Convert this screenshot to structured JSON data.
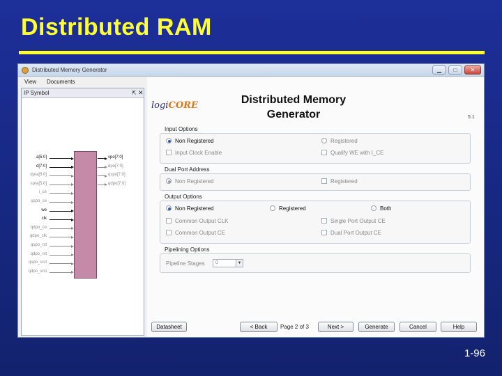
{
  "slide": {
    "title": "Distributed RAM",
    "number": "1-96",
    "title_color": "#ffff33",
    "background_color": "#1a2b8c"
  },
  "window": {
    "title": "Distributed Memory Generator",
    "icon": "app-icon",
    "controls": {
      "minimize": "▁",
      "maximize": "□",
      "close": "✕"
    },
    "menu": [
      "View",
      "Documents"
    ]
  },
  "ip_symbol": {
    "header": "IP Symbol",
    "float_icon": "⇱",
    "close_icon": "✕",
    "block_color": "#c48aa8",
    "left_pins": [
      {
        "label": "a[5:0]",
        "active": true
      },
      {
        "label": "d[7:0]",
        "active": true
      },
      {
        "label": "dpra[5:0]",
        "active": false
      },
      {
        "label": "spra[5:0]",
        "active": false
      },
      {
        "label": "i_ce",
        "active": false
      },
      {
        "label": "qspo_ce",
        "active": false
      },
      {
        "label": "we",
        "active": true
      },
      {
        "label": "clk",
        "active": true
      },
      {
        "label": "qdpo_ce",
        "active": false
      },
      {
        "label": "qdpo_clk",
        "active": false
      },
      {
        "label": "qspo_rst",
        "active": false
      },
      {
        "label": "qdpo_rst",
        "active": false
      },
      {
        "label": "qspo_srst",
        "active": false
      },
      {
        "label": "qdpo_srst",
        "active": false
      }
    ],
    "right_pins": [
      {
        "label": "spo[7:0]",
        "active": true
      },
      {
        "label": "dpo[7:0]",
        "active": false
      },
      {
        "label": "qspo[7:0]",
        "active": false
      },
      {
        "label": "qdpo[7:0]",
        "active": false
      }
    ]
  },
  "header": {
    "logo_prefix": "logi",
    "logo_core": "CORE",
    "title_line1": "Distributed Memory",
    "title_line2": "Generator",
    "version": "5.1"
  },
  "input_options": {
    "title": "Input Options",
    "non_registered": "Non Registered",
    "registered": "Registered",
    "input_clock_enable": "Input Clock Enable",
    "qualify_we": "Qualify WE with I_CE"
  },
  "dual_port_address": {
    "title": "Dual Port Address",
    "non_registered": "Non Registered",
    "registered": "Registered"
  },
  "output_options": {
    "title": "Output Options",
    "non_registered": "Non Registered",
    "registered": "Registered",
    "both": "Both",
    "common_output_clk": "Common Output CLK",
    "single_port_output_ce": "Single Port Output CE",
    "common_output_ce": "Common Output CE",
    "dual_port_output_ce": "Dual Port Output CE"
  },
  "pipelining_options": {
    "title": "Pipelining Options",
    "stages_label": "Pipeline Stages",
    "stages_value": "0"
  },
  "buttons": {
    "datasheet": "Datasheet",
    "back": "< Back",
    "page_indicator": "Page 2 of 3",
    "next": "Next >",
    "generate": "Generate",
    "cancel": "Cancel",
    "help": "Help"
  }
}
